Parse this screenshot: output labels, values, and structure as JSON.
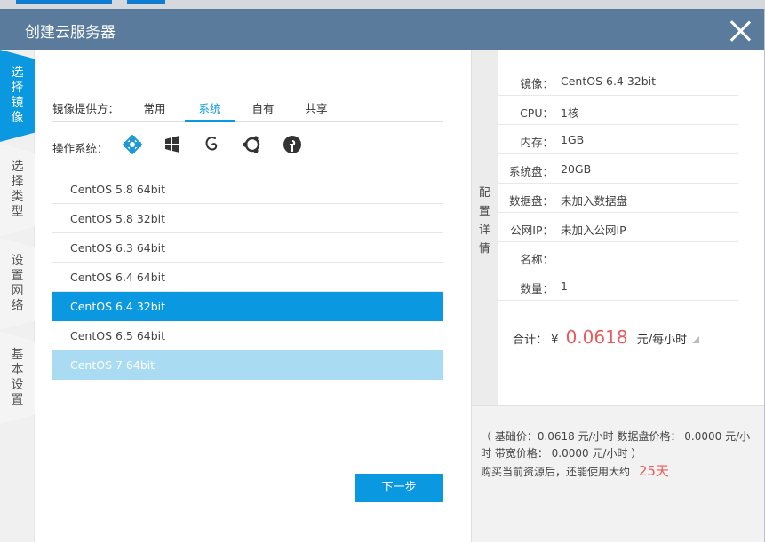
{
  "dialog": {
    "title": "创建云服务器"
  },
  "steps": [
    {
      "label": "选择镜像",
      "active": true
    },
    {
      "label": "选择类型",
      "active": false
    },
    {
      "label": "设置网络",
      "active": false
    },
    {
      "label": "基本设置",
      "active": false
    }
  ],
  "image_source": {
    "label": "镜像提供方：",
    "tabs": [
      "常用",
      "系统",
      "自有",
      "共享"
    ],
    "active_tab": "系统"
  },
  "os": {
    "label": "操作系统：",
    "icons": [
      "centos-icon",
      "windows-icon",
      "debian-icon",
      "ubuntu-icon",
      "fedora-icon"
    ]
  },
  "image_list": [
    {
      "name": "CentOS 5.8 64bit",
      "state": "normal"
    },
    {
      "name": "CentOS 5.8 32bit",
      "state": "normal"
    },
    {
      "name": "CentOS 6.3 64bit",
      "state": "normal"
    },
    {
      "name": "CentOS 6.4 64bit",
      "state": "normal"
    },
    {
      "name": "CentOS 6.4 32bit",
      "state": "selected"
    },
    {
      "name": "CentOS 6.5 64bit",
      "state": "normal"
    },
    {
      "name": "CentOS 7 64bit",
      "state": "disabled"
    }
  ],
  "next_button": "下一步",
  "details_label": "配置详情",
  "config": {
    "rows": [
      {
        "key": "镜像：",
        "value": "CentOS 6.4 32bit"
      },
      {
        "key": "CPU：",
        "value": "1核"
      },
      {
        "key": "内存：",
        "value": "1GB"
      },
      {
        "key": "系统盘：",
        "value": "20GB"
      },
      {
        "key": "数据盘：",
        "value": "未加入数据盘"
      },
      {
        "key": "公网IP：",
        "value": "未加入公网IP"
      },
      {
        "key": "名称：",
        "value": ""
      },
      {
        "key": "数量：",
        "value": "1"
      }
    ],
    "total_label": "合计：",
    "currency": "¥",
    "total_value": "0.0618",
    "total_unit": "元/每小时"
  },
  "pricing": {
    "detail": "（ 基础价：0.0618 元/小时   数据盘价格： 0.0000 元/小时   带宽价格： 0.0000 元/小时  ）",
    "remain_prefix": "购买当前资源后，还能使用大约",
    "remain_days": "25天"
  },
  "colors": {
    "header": "#5a7b9c",
    "accent": "#0a99e0",
    "price": "#e85c5c"
  }
}
